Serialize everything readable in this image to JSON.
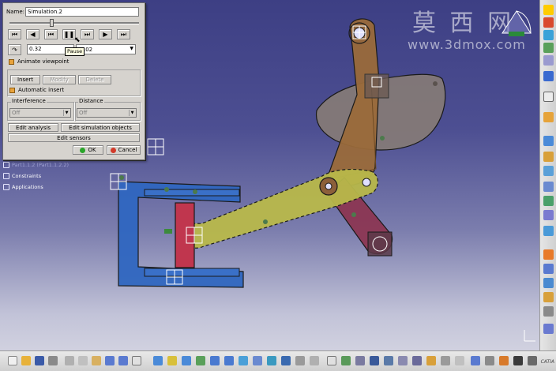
{
  "dialog": {
    "name_label": "Name:",
    "name_value": "Simulation.2",
    "value_field": "0.32",
    "step_value": ".02",
    "tooltip": "Pause",
    "animate_viewpoint": "Animate viewpoint",
    "insert_label": "Insert",
    "modify_label": "Modify",
    "delete_label": "Delete",
    "automatic_insert": "Automatic insert",
    "interference_label": "Interference",
    "interference_value": "Off",
    "distance_label": "Distance",
    "distance_value": "Off",
    "edit_analysis": "Edit analysis",
    "edit_simulation_objects": "Edit simulation objects",
    "edit_sensors": "Edit sensors",
    "ok_label": "OK",
    "cancel_label": "Cancel"
  },
  "tree": {
    "items": [
      "Part1.1.2 (Part1.1.2.2)",
      "Constraints",
      "Applications"
    ]
  },
  "watermark": {
    "chinese": "莫 西 网",
    "url": "www.3dmox.com"
  },
  "status": {
    "brand": "CATIA"
  },
  "colors": {
    "background_top": "#3d3f84",
    "background_bottom": "#d9d9e4",
    "blue_part": "#2f66c0",
    "red_part": "#c0364e",
    "yellow_part": "#b8b84a",
    "brown_part": "#9a6a3a",
    "gray_part": "#857b76",
    "dialog_bg": "#d6d3ce"
  }
}
